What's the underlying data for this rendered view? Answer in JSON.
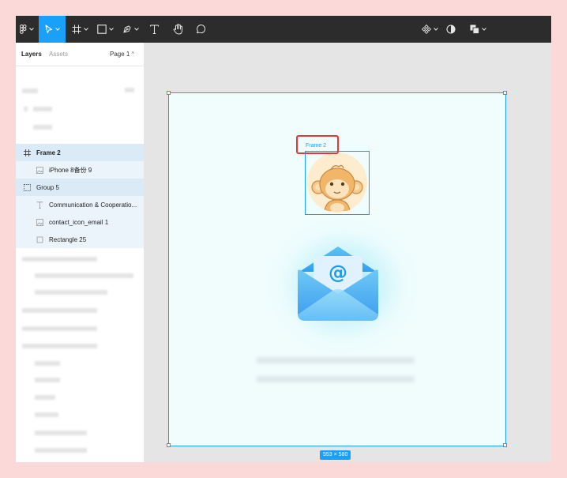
{
  "panel": {
    "tab_layers": "Layers",
    "tab_assets": "Assets",
    "page_label": "Page 1"
  },
  "layers": [
    {
      "label": "Frame 2",
      "icon": "frame-icon",
      "state": "selected"
    },
    {
      "label": "iPhone 8备份 9",
      "icon": "image-icon",
      "state": "child"
    },
    {
      "label": "Group 5",
      "icon": "group-icon",
      "state": "selected"
    },
    {
      "label": "Communication & Cooperatio...",
      "icon": "text-icon",
      "state": "child"
    },
    {
      "label": "contact_icon_email 1",
      "icon": "image-icon",
      "state": "child"
    },
    {
      "label": "Rectangle 25",
      "icon": "rectangle-icon",
      "state": "child"
    }
  ],
  "canvas": {
    "frame_label": "Frame 2",
    "size_badge": "553 × 580",
    "mail_symbol": "@"
  },
  "colors": {
    "accent": "#18a0fb",
    "toolbar": "#2c2c2c",
    "selection_row": "#daebf7",
    "highlight": "#e53935",
    "frame_fill": "#f1fdfd"
  }
}
